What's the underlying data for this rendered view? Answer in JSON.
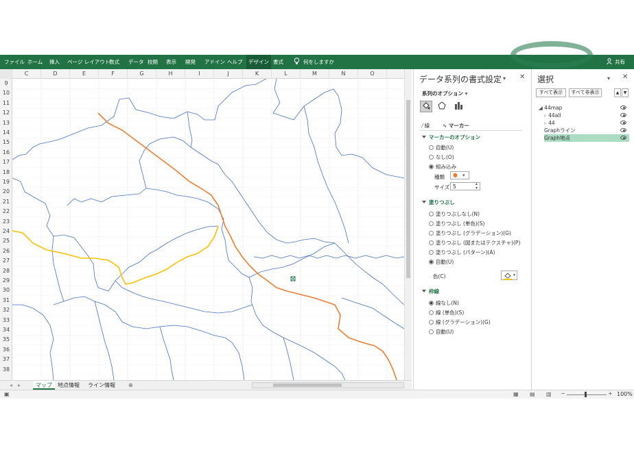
{
  "ribbon": {
    "tabs": [
      "ファイル",
      "ホーム",
      "挿入",
      "ページ レイアウト",
      "数式",
      "データ",
      "校閲",
      "表示",
      "開発",
      "アドイン",
      "ヘルプ",
      "デザイン",
      "書式"
    ],
    "tell_me": "何をしますか",
    "share": "共有"
  },
  "sheet": {
    "columns": [
      "C",
      "D",
      "E",
      "F",
      "G",
      "H",
      "I",
      "J",
      "K",
      "L",
      "M",
      "N",
      "O"
    ],
    "rows": [
      "9",
      "10",
      "11",
      "12",
      "13",
      "14",
      "15",
      "16",
      "17",
      "18",
      "19",
      "20",
      "21",
      "22",
      "23",
      "24",
      "25",
      "26",
      "27",
      "28",
      "29",
      "30",
      "31",
      "32",
      "33",
      "34",
      "35",
      "36",
      "37",
      "38"
    ],
    "map_colors": {
      "border": "#4472c4",
      "route_orange": "#ed7d31",
      "route_yellow": "#ffc000"
    }
  },
  "sheet_tabs": [
    "マップ",
    "地点情報",
    "ライン情報"
  ],
  "format_pane": {
    "title": "データ系列の書式設定",
    "options_label": "系列のオプション",
    "tab_line": "線",
    "tab_marker": "マーカー",
    "marker_section": "マーカーのオプション",
    "marker_options": [
      "自動(U)",
      "なし(O)",
      "組み込み"
    ],
    "type_label": "種類",
    "size_label": "サイズ",
    "size_value": "5",
    "fill_section": "塗りつぶし",
    "fill_options": [
      "塗りつぶしなし(N)",
      "塗りつぶし (単色)(S)",
      "塗りつぶし (グラデーション)(G)",
      "塗りつぶし (図またはテクスチャ)(P)",
      "塗りつぶし (パターン)(A)",
      "自動(U)"
    ],
    "color_label": "色(C)",
    "border_section": "枠線",
    "border_options": [
      "線なし(N)",
      "線 (単色)(S)",
      "線 (グラデーション)(G)",
      "自動(U)"
    ]
  },
  "selection_pane": {
    "title": "選択",
    "show_all": "すべて表示",
    "hide_all": "すべて非表示",
    "items": [
      "44map",
      "44all",
      "44",
      "Graphライン",
      "Graph地点"
    ]
  },
  "status": {
    "zoom": "100%"
  }
}
